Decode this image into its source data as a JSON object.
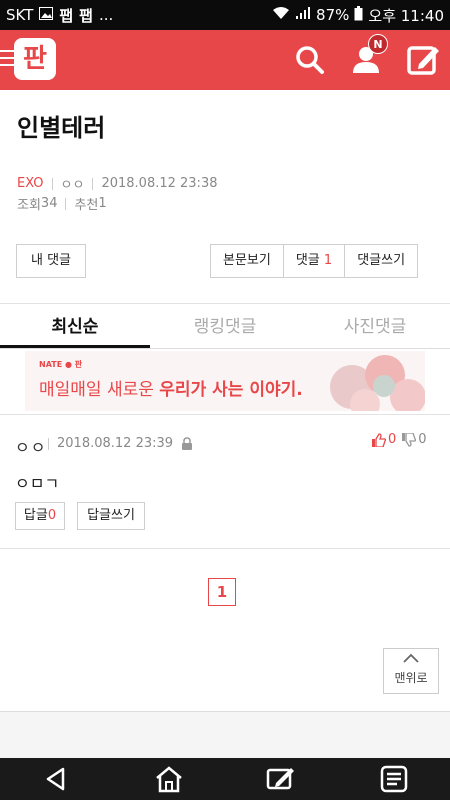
{
  "status_bar": {
    "carrier": "SKT",
    "notif1": "팹",
    "notif2": "팹",
    "more": "...",
    "battery": "87%",
    "time": "오후 11:40"
  },
  "header": {
    "logo_text": "판",
    "badge": "N"
  },
  "post": {
    "title": "인별테러",
    "category": "EXO",
    "author": "ㅇㅇ",
    "datetime": "2018.08.12 23:38",
    "views_label": "조회",
    "views": "34",
    "recommend_label": "추천",
    "recommend": "1"
  },
  "actions": {
    "my_comment": "내 댓글",
    "view_post": "본문보기",
    "comments_label": "댓글",
    "comments_count": "1",
    "write_comment": "댓글쓰기"
  },
  "tabs": [
    {
      "label": "최신순",
      "active": true
    },
    {
      "label": "랭킹댓글",
      "active": false
    },
    {
      "label": "사진댓글",
      "active": false
    }
  ],
  "banner": {
    "brand": "NATE ● 판",
    "text_normal": "매일매일 새로운",
    "text_bold": "우리가 사는 이야기."
  },
  "comment": {
    "author": "ㅇㅇ",
    "datetime": "2018.08.12 23:39",
    "likes": "0",
    "dislikes": "0",
    "body": "ㅇㅁㄱ",
    "reply_label": "답글",
    "reply_count": "0",
    "reply_write": "답글쓰기"
  },
  "pagination": {
    "current": "1"
  },
  "to_top": "맨위로",
  "colors": {
    "brand_red": "#e8474a",
    "nav_bg": "#1a1a1a"
  }
}
